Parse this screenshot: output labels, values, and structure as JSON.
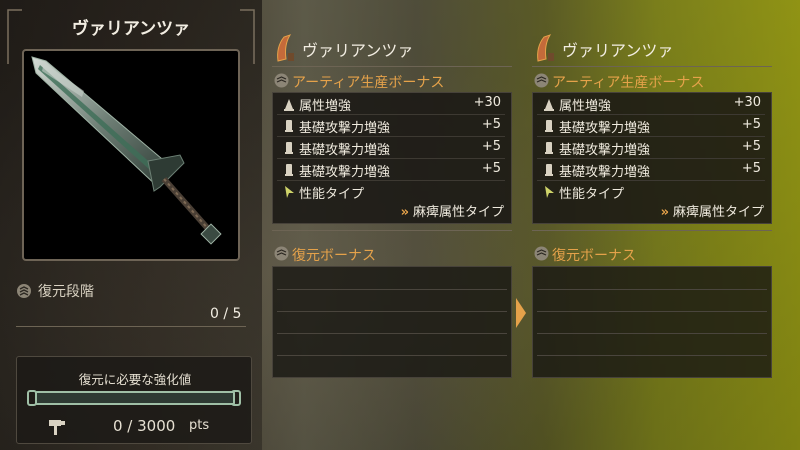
{
  "weapon_name": "ヴァリアンツァ",
  "restore_stage": {
    "label": "復元段階",
    "count": "0 / 5"
  },
  "requirement": {
    "title": "復元に必要な強化値",
    "current": "0",
    "max": "3000",
    "points_text": "0 / 3000",
    "unit": "pts",
    "progress": 0
  },
  "panels": [
    {
      "weapon_name": "ヴァリアンツァ",
      "bonus_title": "アーティア生産ボーナス",
      "bonuses": [
        {
          "icon": "element-boost-icon",
          "label": "属性増強",
          "value": "+30"
        },
        {
          "icon": "attack-boost-icon",
          "label": "基礎攻撃力増強",
          "value": "+5"
        },
        {
          "icon": "attack-boost-icon",
          "label": "基礎攻撃力増強",
          "value": "+5"
        },
        {
          "icon": "attack-boost-icon",
          "label": "基礎攻撃力増強",
          "value": "+5"
        },
        {
          "icon": "performance-type-icon",
          "label": "性能タイプ",
          "value": ""
        }
      ],
      "type_value": "麻痺属性タイプ",
      "restore_title": "復元ボーナス"
    },
    {
      "weapon_name": "ヴァリアンツァ",
      "bonus_title": "アーティア生産ボーナス",
      "bonuses": [
        {
          "icon": "element-boost-icon",
          "label": "属性増強",
          "value": "+30"
        },
        {
          "icon": "attack-boost-icon",
          "label": "基礎攻撃力増強",
          "value": "+5"
        },
        {
          "icon": "attack-boost-icon",
          "label": "基礎攻撃力増強",
          "value": "+5"
        },
        {
          "icon": "attack-boost-icon",
          "label": "基礎攻撃力増強",
          "value": "+5"
        },
        {
          "icon": "performance-type-icon",
          "label": "性能タイプ",
          "value": ""
        }
      ],
      "type_value": "麻痺属性タイプ",
      "restore_title": "復元ボーナス"
    }
  ],
  "colors": {
    "accent_orange": "#e5a24a",
    "gauge_green": "#8ec29a",
    "highlight_yellow": "#a9ad18"
  }
}
